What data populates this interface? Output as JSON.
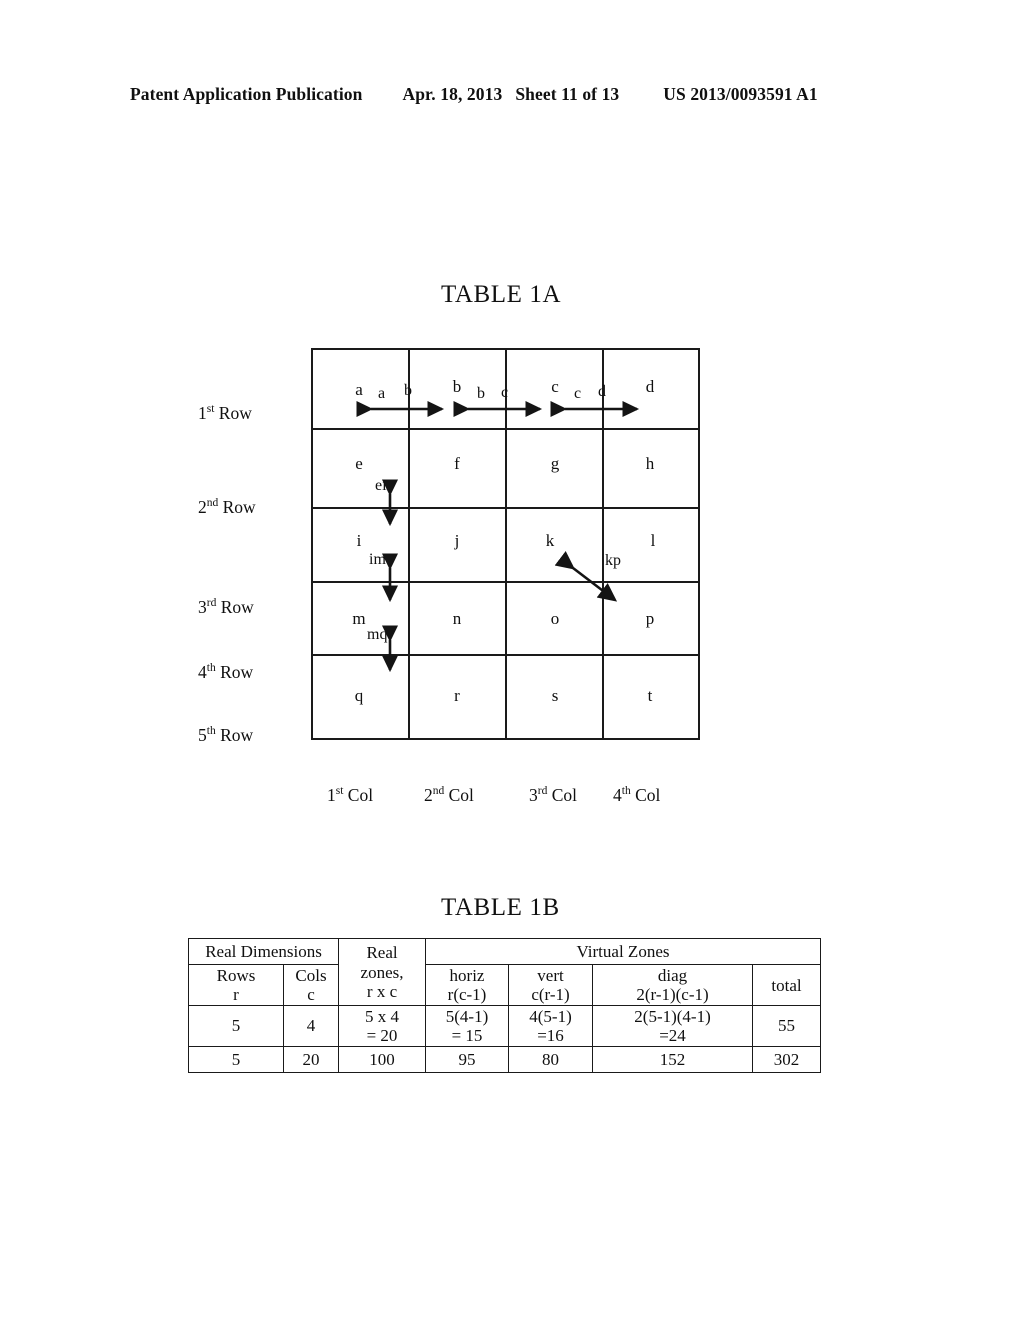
{
  "header": {
    "publication": "Patent Application Publication",
    "date": "Apr. 18, 2013",
    "sheet": "Sheet 11 of 13",
    "patent_number": "US 2013/0093591 A1"
  },
  "table1a": {
    "title": "TABLE 1A",
    "row_labels": [
      {
        "ordinal": "1",
        "suffix": "st",
        "text": "Row"
      },
      {
        "ordinal": "2",
        "suffix": "nd",
        "text": "Row"
      },
      {
        "ordinal": "3",
        "suffix": "rd",
        "text": "Row"
      },
      {
        "ordinal": "4",
        "suffix": "th",
        "text": "Row"
      },
      {
        "ordinal": "5",
        "suffix": "th",
        "text": "Row"
      }
    ],
    "col_labels": [
      {
        "ordinal": "1",
        "suffix": "st",
        "text": "Col"
      },
      {
        "ordinal": "2",
        "suffix": "nd",
        "text": "Col"
      },
      {
        "ordinal": "3",
        "suffix": "rd",
        "text": "Col"
      },
      {
        "ordinal": "4",
        "suffix": "th",
        "text": "Col"
      }
    ],
    "cells": [
      [
        "a",
        "b",
        "c",
        "d"
      ],
      [
        "e",
        "f",
        "g",
        "h"
      ],
      [
        "i",
        "j",
        "k",
        "l"
      ],
      [
        "m",
        "n",
        "o",
        "p"
      ],
      [
        "q",
        "r",
        "s",
        "t"
      ]
    ],
    "zone_arrows": {
      "horizontal": [
        {
          "left_label": "a",
          "right_label": "b"
        },
        {
          "left_label": "b",
          "right_label": "c"
        },
        {
          "left_label": "c",
          "right_label": "d"
        }
      ],
      "vertical": [
        {
          "label": "ei"
        },
        {
          "label": "im"
        },
        {
          "label": "mq"
        }
      ],
      "diagonal": [
        {
          "label": "kp"
        }
      ]
    }
  },
  "table1b": {
    "title": "TABLE 1B",
    "group_headers": {
      "real_dimensions": "Real Dimensions",
      "real_zones": "Real",
      "real_zones_line2": "zones,",
      "real_zones_line3": "r x c",
      "virtual_zones": "Virtual Zones"
    },
    "columns": [
      {
        "name": "Rows",
        "formula": "r"
      },
      {
        "name": "Cols",
        "formula": "c"
      },
      {
        "name": "horiz",
        "formula": "r(c-1)"
      },
      {
        "name": "vert",
        "formula": "c(r-1)"
      },
      {
        "name": "diag",
        "formula": "2(r-1)(c-1)"
      },
      {
        "name": "total",
        "formula": ""
      }
    ],
    "rows": [
      {
        "rows": "5",
        "cols": "4",
        "real_zones": "5 x 4",
        "real_zones_result": "= 20",
        "horiz": "5(4-1)",
        "horiz_result": "= 15",
        "vert": "4(5-1)",
        "vert_result": "=16",
        "diag": "2(5-1)(4-1)",
        "diag_result": "=24",
        "total": "55"
      },
      {
        "rows": "5",
        "cols": "20",
        "real_zones": "100",
        "real_zones_result": "",
        "horiz": "95",
        "horiz_result": "",
        "vert": "80",
        "vert_result": "",
        "diag": "152",
        "diag_result": "",
        "total": "302"
      }
    ]
  }
}
